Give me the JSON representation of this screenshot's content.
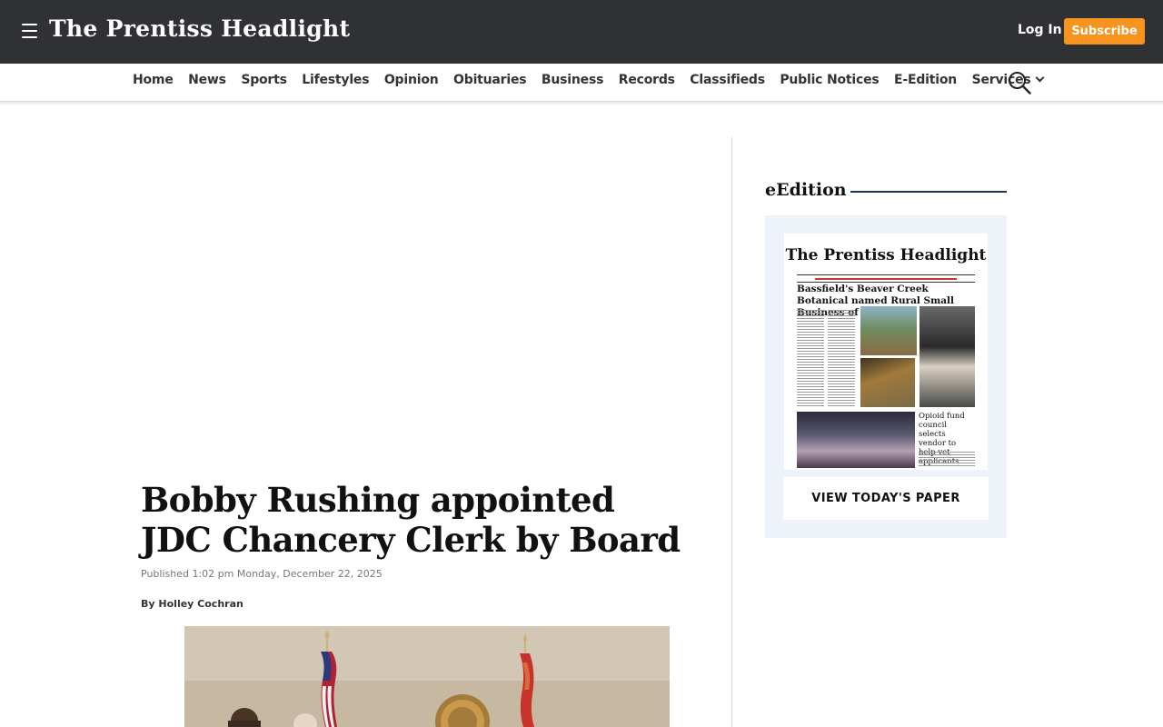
{
  "header": {
    "site_name": "The Prentiss Headlight",
    "login_label": "Log In",
    "subscribe_label": "Subscribe"
  },
  "nav": {
    "items": [
      {
        "label": "Home"
      },
      {
        "label": "News"
      },
      {
        "label": "Sports"
      },
      {
        "label": "Lifestyles"
      },
      {
        "label": "Opinion"
      },
      {
        "label": "Obituaries"
      },
      {
        "label": "Business"
      },
      {
        "label": "Records"
      },
      {
        "label": "Classifieds"
      },
      {
        "label": "Public Notices"
      },
      {
        "label": "E-Edition"
      },
      {
        "label": "Services"
      }
    ],
    "services_has_dropdown": true,
    "icons": [
      "menu-icon",
      "search-icon",
      "chevron-down-icon"
    ]
  },
  "article": {
    "headline": "Bobby Rushing appointed JDC Chancery Clerk by Board",
    "published": "Published 1:02 pm Monday, December 22, 2025",
    "byline_prefix": "By",
    "author": "Holley Cochran"
  },
  "sidebar": {
    "section_title": "eEdition",
    "paper": {
      "masthead": "The Prentiss Headlight",
      "lead_headline": "Bassfield's Beaver Creek Botanical named Rural Small Business of the Year",
      "secondary_headline": "Opioid fund council selects vendor to help vet applicants"
    },
    "view_button_label": "VIEW TODAY'S PAPER"
  },
  "colors": {
    "topbar_bg": "#2f3135",
    "subscribe_bg": "#f7941d",
    "sidebar_rule": "#1d3557",
    "eedition_panel_bg": "#eef3fa"
  }
}
